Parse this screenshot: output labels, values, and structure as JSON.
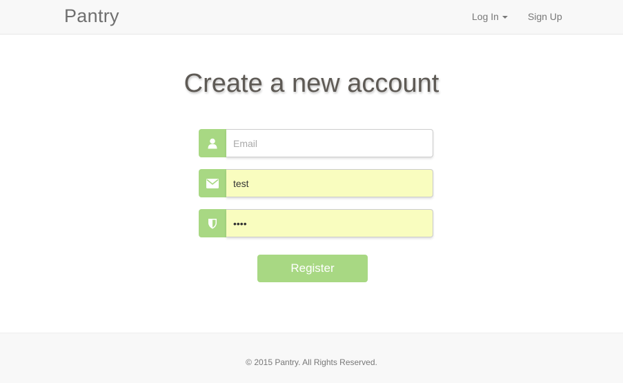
{
  "navbar": {
    "brand": "Pantry",
    "login_label": "Log In",
    "signup_label": "Sign Up"
  },
  "main": {
    "title": "Create a new account",
    "email": {
      "placeholder": "Email",
      "value": "",
      "icon": "user-icon"
    },
    "username": {
      "value": "test",
      "icon": "envelope-icon"
    },
    "password": {
      "value": "test",
      "icon": "shield-icon"
    },
    "register_label": "Register"
  },
  "footer": {
    "text": "© 2015 Pantry. All Rights Reserved."
  },
  "colors": {
    "accent": "#a8d883",
    "autofill": "#f9fdbf",
    "navbar_bg": "#f8f8f8"
  }
}
